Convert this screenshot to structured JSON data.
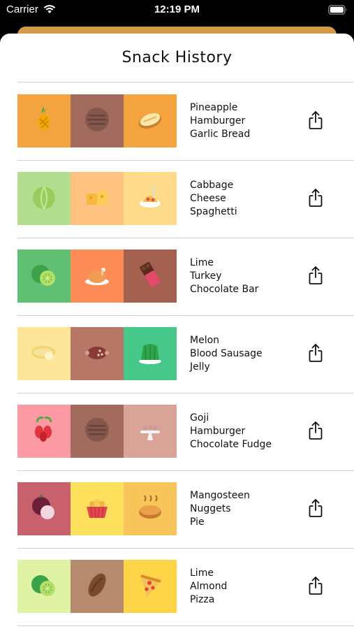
{
  "status_bar": {
    "carrier": "Carrier",
    "time": "12:19 PM"
  },
  "title": "Snack History",
  "icons": {
    "share": "share-icon",
    "wifi": "wifi-icon",
    "battery": "battery-icon"
  },
  "rows": [
    {
      "snacks": [
        {
          "name": "Pineapple",
          "icon": "pineapple-icon",
          "color": "#f3a43e"
        },
        {
          "name": "Hamburger",
          "icon": "hamburger-icon",
          "color": "#a26b5e"
        },
        {
          "name": "Garlic Bread",
          "icon": "garlic-bread-icon",
          "color": "#f3a43e"
        }
      ]
    },
    {
      "snacks": [
        {
          "name": "Cabbage",
          "icon": "cabbage-icon",
          "color": "#b3de8f"
        },
        {
          "name": "Cheese",
          "icon": "cheese-icon",
          "color": "#fdc27f"
        },
        {
          "name": "Spaghetti",
          "icon": "spaghetti-icon",
          "color": "#fdd98a"
        }
      ]
    },
    {
      "snacks": [
        {
          "name": "Lime",
          "icon": "lime-icon",
          "color": "#5fbf73"
        },
        {
          "name": "Turkey",
          "icon": "turkey-icon",
          "color": "#fd8c57"
        },
        {
          "name": "Chocolate Bar",
          "icon": "chocolate-bar-icon",
          "color": "#a5614f"
        }
      ]
    },
    {
      "snacks": [
        {
          "name": "Melon",
          "icon": "melon-icon",
          "color": "#fde59a"
        },
        {
          "name": "Blood Sausage",
          "icon": "blood-sausage-icon",
          "color": "#b77766"
        },
        {
          "name": "Jelly",
          "icon": "jelly-icon",
          "color": "#45c88a"
        }
      ]
    },
    {
      "snacks": [
        {
          "name": "Goji",
          "icon": "goji-icon",
          "color": "#fc9aa3"
        },
        {
          "name": "Hamburger",
          "icon": "hamburger-icon",
          "color": "#a26b5e"
        },
        {
          "name": "Chocolate Fudge",
          "icon": "chocolate-fudge-icon",
          "color": "#d9a497"
        }
      ]
    },
    {
      "snacks": [
        {
          "name": "Mangosteen",
          "icon": "mangosteen-icon",
          "color": "#c9616c"
        },
        {
          "name": "Nuggets",
          "icon": "nuggets-icon",
          "color": "#fde05c"
        },
        {
          "name": "Pie",
          "icon": "pie-icon",
          "color": "#f7c55a"
        }
      ]
    },
    {
      "snacks": [
        {
          "name": "Lime",
          "icon": "lime-icon",
          "color": "#e0f2a4"
        },
        {
          "name": "Almond",
          "icon": "almond-icon",
          "color": "#b58a6e"
        },
        {
          "name": "Pizza",
          "icon": "pizza-icon",
          "color": "#fdd546"
        }
      ]
    }
  ]
}
